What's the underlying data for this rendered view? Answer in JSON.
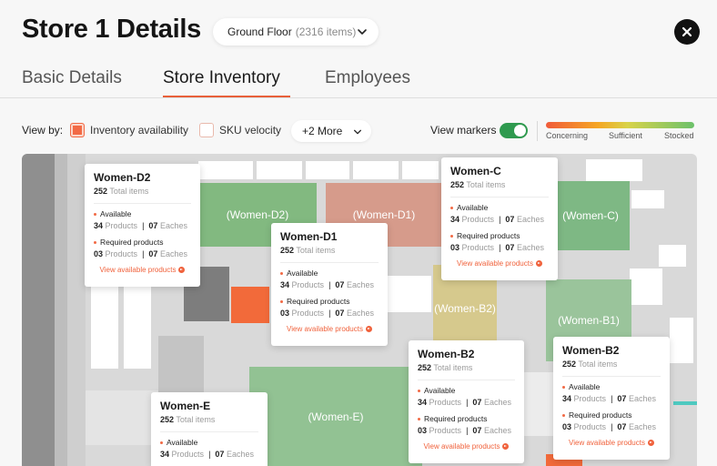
{
  "header": {
    "title": "Store 1 Details",
    "floor": {
      "label": "Ground Floor",
      "count": "(2316 items)"
    },
    "close_icon": "close-icon"
  },
  "tabs": [
    {
      "label": "Basic Details",
      "active": false
    },
    {
      "label": "Store Inventory",
      "active": true
    },
    {
      "label": "Employees",
      "active": false
    }
  ],
  "filters": {
    "view_by_label": "View by:",
    "options": [
      {
        "label": "Inventory availability",
        "checked": true
      },
      {
        "label": "SKU velocity",
        "checked": false
      }
    ],
    "more_label": "+2 More",
    "view_markers_label": "View markers",
    "view_markers_on": true,
    "legend": [
      "Concerning",
      "Sufficient",
      "Stocked"
    ],
    "colors": {
      "accent": "#f26a45",
      "toggle": "#2f9a4f"
    }
  },
  "zones": {
    "women_d2": "(Women-D2)",
    "women_d1": "(Women-D1)",
    "women_c": "(Women-C)",
    "women_b2": "(Women-B2)",
    "women_b1": "(Women-B1)",
    "women_e": "(Women-E)"
  },
  "cards": [
    {
      "title": "Women-D2",
      "total_num": "252",
      "total_text": "Total items",
      "available_label": "Available",
      "avail_products_num": "34",
      "products_text": "Products",
      "avail_eaches_num": "07",
      "eaches_text": "Eaches",
      "required_label": "Required products",
      "req_products_num": "03",
      "req_eaches_num": "07",
      "link": "View available products"
    },
    {
      "title": "Women-C",
      "total_num": "252",
      "total_text": "Total items",
      "available_label": "Available",
      "avail_products_num": "34",
      "products_text": "Products",
      "avail_eaches_num": "07",
      "eaches_text": "Eaches",
      "required_label": "Required products",
      "req_products_num": "03",
      "req_eaches_num": "07",
      "link": "View available products"
    },
    {
      "title": "Women-D1",
      "total_num": "252",
      "total_text": "Total items",
      "available_label": "Available",
      "avail_products_num": "34",
      "products_text": "Products",
      "avail_eaches_num": "07",
      "eaches_text": "Eaches",
      "required_label": "Required products",
      "req_products_num": "03",
      "req_eaches_num": "07",
      "link": "View available products"
    },
    {
      "title": "Women-B2",
      "total_num": "252",
      "total_text": "Total items",
      "available_label": "Available",
      "avail_products_num": "34",
      "products_text": "Products",
      "avail_eaches_num": "07",
      "eaches_text": "Eaches",
      "required_label": "Required products",
      "req_products_num": "03",
      "req_eaches_num": "07",
      "link": "View available products"
    },
    {
      "title": "Women-B2",
      "total_num": "252",
      "total_text": "Total items",
      "available_label": "Available",
      "avail_products_num": "34",
      "products_text": "Products",
      "avail_eaches_num": "07",
      "eaches_text": "Eaches",
      "required_label": "Required products",
      "req_products_num": "03",
      "req_eaches_num": "07",
      "link": "View available products"
    },
    {
      "title": "Women-E",
      "total_num": "252",
      "total_text": "Total items",
      "available_label": "Available",
      "avail_products_num": "34",
      "products_text": "Products",
      "avail_eaches_num": "07",
      "eaches_text": "Eaches"
    }
  ]
}
